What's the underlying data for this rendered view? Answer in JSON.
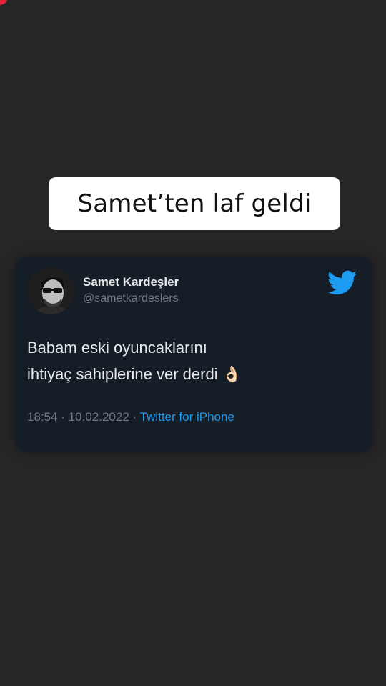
{
  "caption": {
    "text": "Samet’ten laf geldi"
  },
  "tweet": {
    "user_name": "Samet Kardeşler",
    "user_handle": "@sametkardeslers",
    "avatar_icon": "profile-photo-sunglasses",
    "logo_icon": "twitter-bird-icon",
    "body_lines": [
      "Babam eski oyuncaklarını",
      "ihtiyaç sahiplerine ver derdi"
    ],
    "emoji": "👌🏻",
    "time": "18:54",
    "date": "10.02.2022",
    "separator": "·",
    "source": "Twitter for iPhone"
  },
  "colors": {
    "background": "#262626",
    "card": "#151d27",
    "accent_blue": "#1d9bf0",
    "muted_text": "#6e7a86",
    "primary_text": "#e7e9ea",
    "corner_mark": "#e0243b"
  }
}
